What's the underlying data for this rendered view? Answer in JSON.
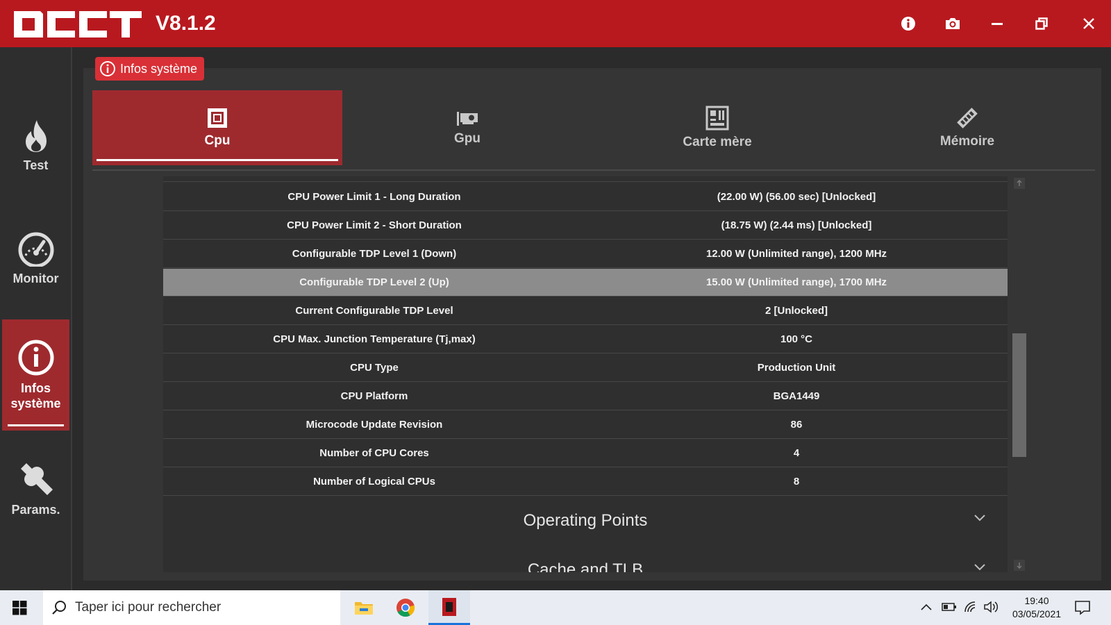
{
  "app": {
    "logo_text": "OCCT",
    "version": "V8.1.2"
  },
  "window_controls": {
    "info": "info-icon",
    "screenshot": "camera-icon",
    "minimize": "minimize-icon",
    "restore": "restore-icon",
    "close": "close-icon"
  },
  "sidebar": {
    "items": [
      {
        "label": "Test",
        "icon": "flame-icon"
      },
      {
        "label": "Monitor",
        "icon": "gauge-icon"
      },
      {
        "label": "Infos système",
        "icon": "info-icon"
      },
      {
        "label": "Params.",
        "icon": "wrench-icon"
      }
    ],
    "active": "Infos système"
  },
  "section": {
    "title": "Infos système"
  },
  "tabs": [
    {
      "label": "Cpu",
      "icon": "cpu-icon"
    },
    {
      "label": "Gpu",
      "icon": "gpu-icon"
    },
    {
      "label": "Carte mère",
      "icon": "motherboard-icon"
    },
    {
      "label": "Mémoire",
      "icon": "memory-icon"
    }
  ],
  "active_tab": "Cpu",
  "table": {
    "rows": [
      {
        "key": "CPU Power Limit 1 - Long Duration",
        "value": "(22.00 W) (56.00 sec) [Unlocked]"
      },
      {
        "key": "CPU Power Limit 2 - Short Duration",
        "value": "(18.75 W) (2.44 ms) [Unlocked]"
      },
      {
        "key": "Configurable TDP Level 1 (Down)",
        "value": "12.00 W (Unlimited range), 1200 MHz"
      },
      {
        "key": "Configurable TDP Level 2 (Up)",
        "value": "15.00 W (Unlimited range), 1700 MHz"
      },
      {
        "key": "Current Configurable TDP Level",
        "value": "2 [Unlocked]"
      },
      {
        "key": "CPU Max. Junction Temperature (Tj,max)",
        "value": "100 °C"
      },
      {
        "key": "CPU Type",
        "value": "Production Unit"
      },
      {
        "key": "CPU Platform",
        "value": "BGA1449"
      },
      {
        "key": "Microcode Update Revision",
        "value": "86"
      },
      {
        "key": "Number of CPU Cores",
        "value": "4"
      },
      {
        "key": "Number of Logical CPUs",
        "value": "8"
      }
    ],
    "selected_row": "Configurable TDP Level 2 (Up)",
    "groups": [
      {
        "label": "Operating Points"
      },
      {
        "label": "Cache and TLB"
      }
    ]
  },
  "taskbar": {
    "search_placeholder": "Taper ici pour rechercher",
    "apps": [
      "file-explorer-icon",
      "chrome-icon",
      "occt-icon"
    ],
    "active_app": "occt-icon",
    "clock_time": "19:40",
    "clock_date": "03/05/2021"
  },
  "colors": {
    "brand_red": "#b8191f",
    "active_red": "#9e2a2e",
    "badge_red": "#d83036",
    "selected_row": "#8c8c8c"
  }
}
